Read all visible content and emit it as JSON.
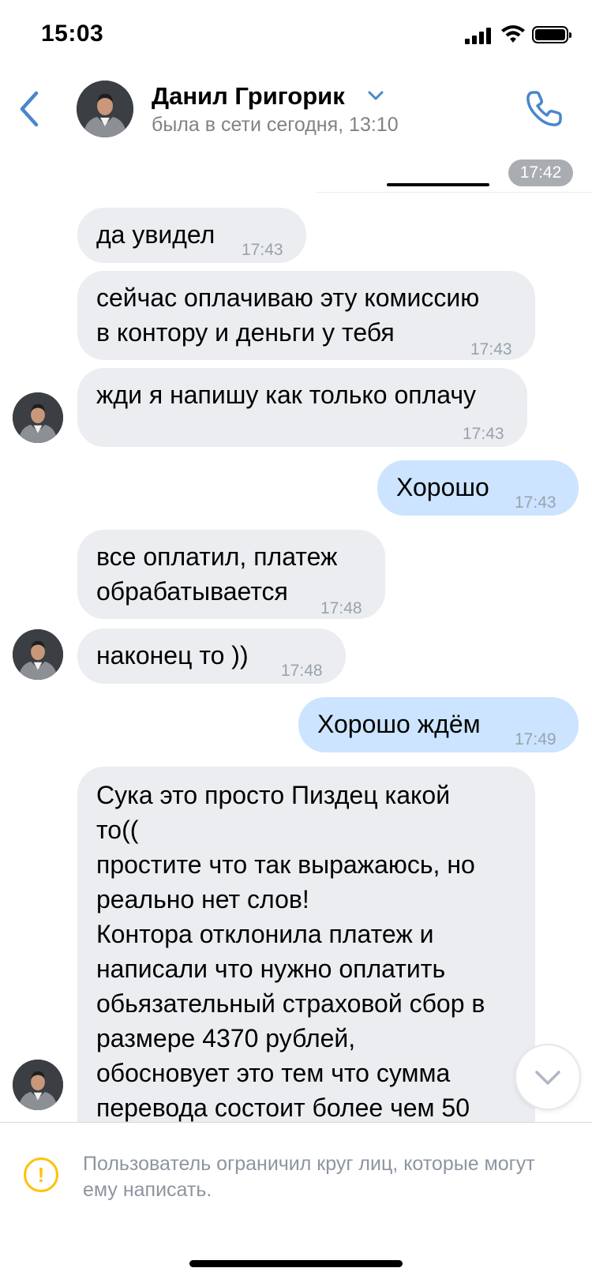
{
  "status_bar": {
    "time": "15:03"
  },
  "header": {
    "contact_name": "Данил Григорик",
    "contact_status": "была в сети сегодня, 13:10"
  },
  "timestamp_pill": "17:42",
  "messages": [
    {
      "dir": "in",
      "lines": [
        "да увидел"
      ],
      "time": "17:43"
    },
    {
      "dir": "in",
      "lines": [
        "сейчас оплачиваю эту комиссию",
        "в контору и деньги у тебя"
      ],
      "time": "17:43"
    },
    {
      "dir": "in",
      "lines": [
        "жди я напишу как только оплачу"
      ],
      "time": "17:43"
    },
    {
      "dir": "out",
      "lines": [
        "Хорошо"
      ],
      "time": "17:43"
    },
    {
      "dir": "in",
      "lines": [
        "все оплатил, платеж",
        "обрабатывается"
      ],
      "time": "17:48"
    },
    {
      "dir": "in",
      "lines": [
        "наконец то ))"
      ],
      "time": "17:48"
    },
    {
      "dir": "out",
      "lines": [
        "Хорошо ждём"
      ],
      "time": "17:49"
    },
    {
      "dir": "in",
      "lines": [
        "Сука это просто Пиздец какой",
        "то((",
        "простите что так выражаюсь, но",
        "реально нет слов!",
        "Контора отклонила платеж и",
        "написали что нужно оплатить",
        "обьязательный страховой сбор в",
        "размере 4370 рублей,",
        "обосновует это тем что сумма",
        "перевода состоит более чем 50"
      ]
    }
  ],
  "footer": {
    "notice": "Пользователь ограничил круг лиц, которые могут ему написать."
  },
  "colors": {
    "incoming_bubble": "#ebedf0",
    "outgoing_bubble": "#cce4ff",
    "accent": "#4986cc",
    "warning": "#ffc107"
  },
  "icons": [
    "back-arrow-icon",
    "chevron-down-icon",
    "phone-icon",
    "chevron-down-scroll-icon",
    "warning-icon"
  ]
}
